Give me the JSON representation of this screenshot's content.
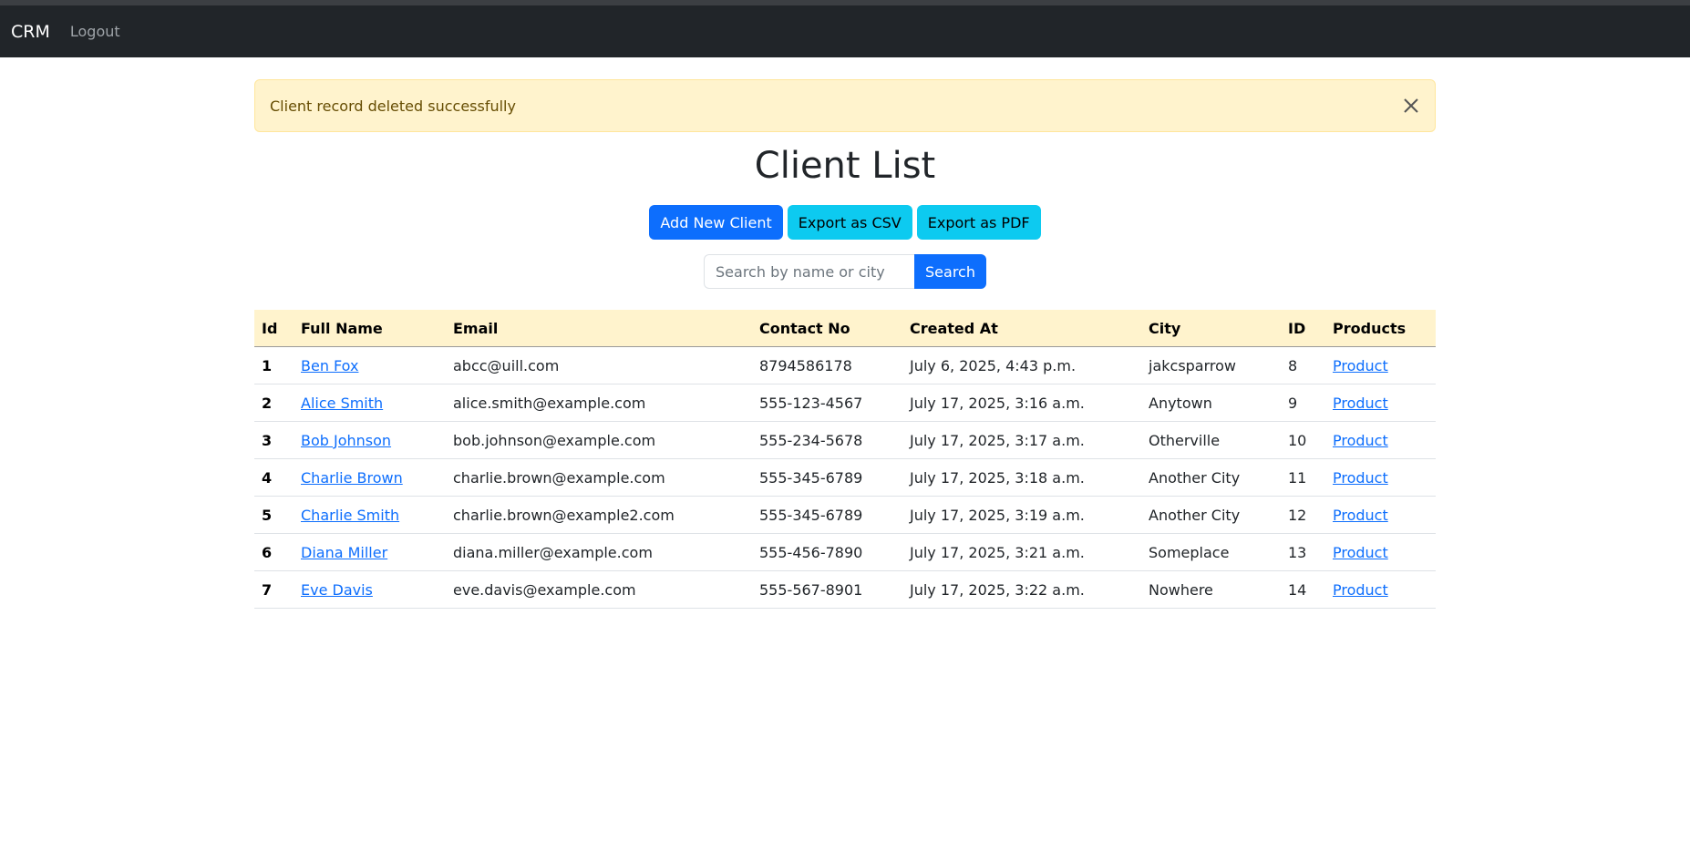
{
  "nav": {
    "brand": "CRM",
    "logout": "Logout"
  },
  "alert": {
    "message": "Client record deleted successfully"
  },
  "page": {
    "title": "Client List"
  },
  "actions": {
    "add_client": "Add New Client",
    "export_csv": "Export as CSV",
    "export_pdf": "Export as PDF"
  },
  "search": {
    "placeholder": "Search by name or city",
    "button": "Search"
  },
  "table": {
    "headers": [
      "Id",
      "Full Name",
      "Email",
      "Contact No",
      "Created At",
      "City",
      "ID",
      "Products"
    ],
    "rows": [
      {
        "id": "1",
        "name": "Ben Fox",
        "email": "abcc@uill.com",
        "contact": "8794586178",
        "created": "July 6, 2025, 4:43 p.m.",
        "city": "jakcsparrow",
        "pid": "8",
        "products": "Product"
      },
      {
        "id": "2",
        "name": "Alice Smith",
        "email": "alice.smith@example.com",
        "contact": "555-123-4567",
        "created": "July 17, 2025, 3:16 a.m.",
        "city": "Anytown",
        "pid": "9",
        "products": "Product"
      },
      {
        "id": "3",
        "name": "Bob Johnson",
        "email": "bob.johnson@example.com",
        "contact": "555-234-5678",
        "created": "July 17, 2025, 3:17 a.m.",
        "city": "Otherville",
        "pid": "10",
        "products": "Product"
      },
      {
        "id": "4",
        "name": "Charlie Brown",
        "email": "charlie.brown@example.com",
        "contact": "555-345-6789",
        "created": "July 17, 2025, 3:18 a.m.",
        "city": "Another City",
        "pid": "11",
        "products": "Product"
      },
      {
        "id": "5",
        "name": "Charlie Smith",
        "email": "charlie.brown@example2.com",
        "contact": "555-345-6789",
        "created": "July 17, 2025, 3:19 a.m.",
        "city": "Another City",
        "pid": "12",
        "products": "Product"
      },
      {
        "id": "6",
        "name": "Diana Miller",
        "email": "diana.miller@example.com",
        "contact": "555-456-7890",
        "created": "July 17, 2025, 3:21 a.m.",
        "city": "Someplace",
        "pid": "13",
        "products": "Product"
      },
      {
        "id": "7",
        "name": "Eve Davis",
        "email": "eve.davis@example.com",
        "contact": "555-567-8901",
        "created": "July 17, 2025, 3:22 a.m.",
        "city": "Nowhere",
        "pid": "14",
        "products": "Product"
      }
    ]
  }
}
